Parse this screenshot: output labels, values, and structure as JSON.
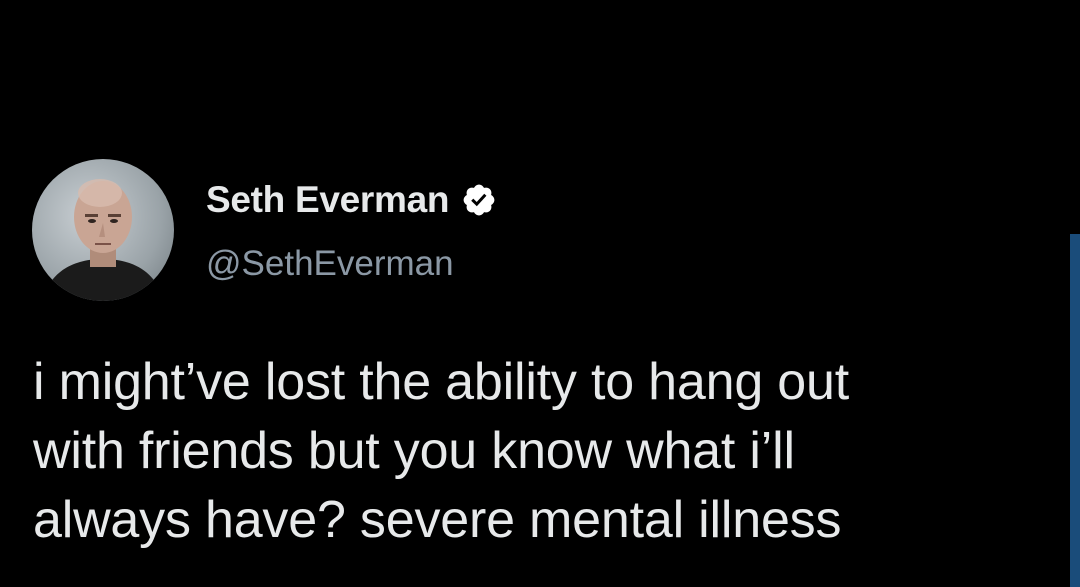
{
  "tweet": {
    "author": {
      "display_name": "Seth Everman",
      "handle": "@SethEverman",
      "verified_icon": "verified-badge-icon"
    },
    "text_lines": [
      "i might’ve lost the ability to hang out",
      "with friends but you know what i’ll",
      "always have? severe mental illness"
    ]
  },
  "colors": {
    "background": "#000000",
    "primary_text": "#e7e9ea",
    "secondary_text": "#8b98a5",
    "edge_accent": "#1a4c7a"
  }
}
